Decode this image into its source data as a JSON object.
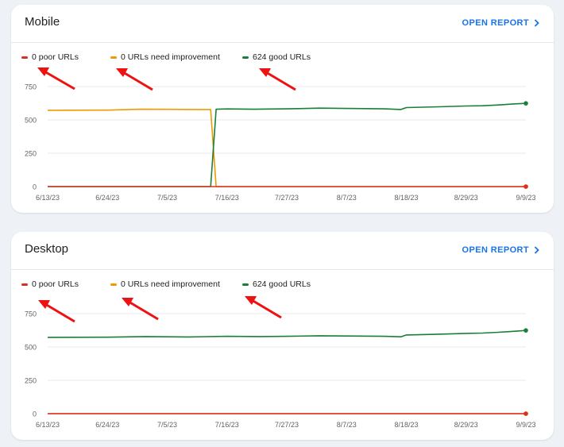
{
  "colors": {
    "poor": "#d93025",
    "needs_improvement": "#f29900",
    "good": "#188038",
    "accent": "#1a73e8",
    "annotation_arrow": "#ee1111"
  },
  "open_report_icon": "chevron-right-icon",
  "annotation_icon": "arrow-icon",
  "sections": [
    {
      "id": "mobile",
      "title": "Mobile",
      "open_report_label": "OPEN REPORT",
      "legend": [
        {
          "key": "poor",
          "label": "0 poor URLs"
        },
        {
          "key": "needs_improvement",
          "label": "0 URLs need improvement"
        },
        {
          "key": "good",
          "label": "624 good URLs"
        }
      ]
    },
    {
      "id": "desktop",
      "title": "Desktop",
      "open_report_label": "OPEN REPORT",
      "legend": [
        {
          "key": "poor",
          "label": "0 poor URLs"
        },
        {
          "key": "needs_improvement",
          "label": "0 URLs need improvement"
        },
        {
          "key": "good",
          "label": "624 good URLs"
        }
      ]
    }
  ],
  "chart_data": [
    {
      "type": "line",
      "ylim": [
        0,
        750
      ],
      "y_ticks": [
        0,
        250,
        500,
        750
      ],
      "x_ticks": [
        "6/13/23",
        "6/24/23",
        "7/5/23",
        "7/16/23",
        "7/27/23",
        "8/7/23",
        "8/18/23",
        "8/29/23",
        "9/9/23"
      ],
      "x_range": [
        "6/13/23",
        "9/9/23"
      ],
      "grid": true,
      "series": [
        {
          "key": "poor",
          "name": "0 poor URLs",
          "x": [
            "6/13/23",
            "9/9/23"
          ],
          "values": [
            0,
            0
          ]
        },
        {
          "key": "needs_improvement",
          "name": "0 URLs need improvement",
          "x": [
            "6/13/23",
            "6/24/23",
            "6/30/23",
            "7/5/23",
            "7/10/23",
            "7/13/23",
            "7/14/23",
            "9/9/23"
          ],
          "values": [
            572,
            573,
            580,
            579,
            578,
            578,
            0,
            0
          ]
        },
        {
          "key": "good",
          "name": "624 good URLs",
          "x": [
            "6/13/23",
            "7/13/23",
            "7/14/23",
            "7/16/23",
            "7/21/23",
            "7/27/23",
            "8/2/23",
            "8/7/23",
            "8/14/23",
            "8/17/23",
            "8/18/23",
            "8/24/23",
            "8/29/23",
            "9/1/23",
            "9/4/23",
            "9/7/23",
            "9/9/23"
          ],
          "values": [
            0,
            0,
            580,
            582,
            580,
            583,
            588,
            586,
            583,
            578,
            592,
            598,
            604,
            606,
            612,
            620,
            624
          ]
        }
      ]
    },
    {
      "type": "line",
      "ylim": [
        0,
        750
      ],
      "y_ticks": [
        0,
        250,
        500,
        750
      ],
      "x_ticks": [
        "6/13/23",
        "6/24/23",
        "7/5/23",
        "7/16/23",
        "7/27/23",
        "8/7/23",
        "8/18/23",
        "8/29/23",
        "9/9/23"
      ],
      "x_range": [
        "6/13/23",
        "9/9/23"
      ],
      "grid": true,
      "series": [
        {
          "key": "poor",
          "name": "0 poor URLs",
          "x": [
            "6/13/23",
            "9/9/23"
          ],
          "values": [
            0,
            0
          ]
        },
        {
          "key": "needs_improvement",
          "name": "0 URLs need improvement",
          "x": [
            "6/13/23",
            "9/9/23"
          ],
          "values": [
            0,
            0
          ]
        },
        {
          "key": "good",
          "name": "624 good URLs",
          "x": [
            "6/13/23",
            "6/24/23",
            "7/1/23",
            "7/9/23",
            "7/16/23",
            "7/22/23",
            "7/27/23",
            "8/2/23",
            "8/7/23",
            "8/14/23",
            "8/17/23",
            "8/18/23",
            "8/24/23",
            "8/29/23",
            "9/1/23",
            "9/4/23",
            "9/7/23",
            "9/9/23"
          ],
          "values": [
            572,
            573,
            578,
            575,
            580,
            578,
            580,
            584,
            582,
            580,
            576,
            590,
            596,
            602,
            604,
            610,
            618,
            624
          ]
        }
      ]
    }
  ]
}
